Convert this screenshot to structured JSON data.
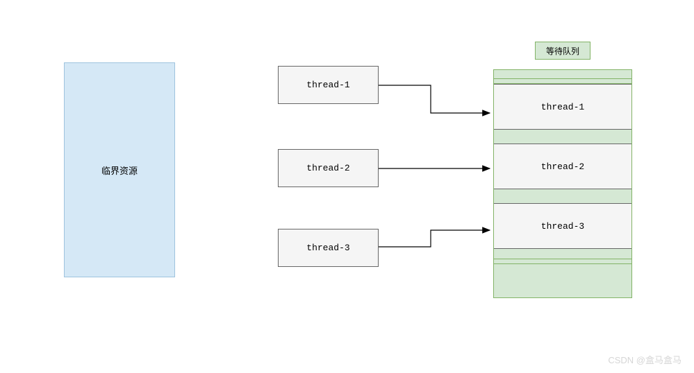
{
  "critical_resource_label": "临界资源",
  "threads": {
    "t1": "thread-1",
    "t2": "thread-2",
    "t3": "thread-3"
  },
  "queue": {
    "title": "等待队列",
    "slots": {
      "s1": "thread-1",
      "s2": "thread-2",
      "s3": "thread-3"
    }
  },
  "watermark": "CSDN @盒马盒马",
  "colors": {
    "critical_bg": "#d5e8f6",
    "critical_border": "#9ec3de",
    "queue_bg": "#d5e8d4",
    "queue_border": "#82b366",
    "box_bg": "#f5f5f5",
    "box_border": "#666666"
  }
}
